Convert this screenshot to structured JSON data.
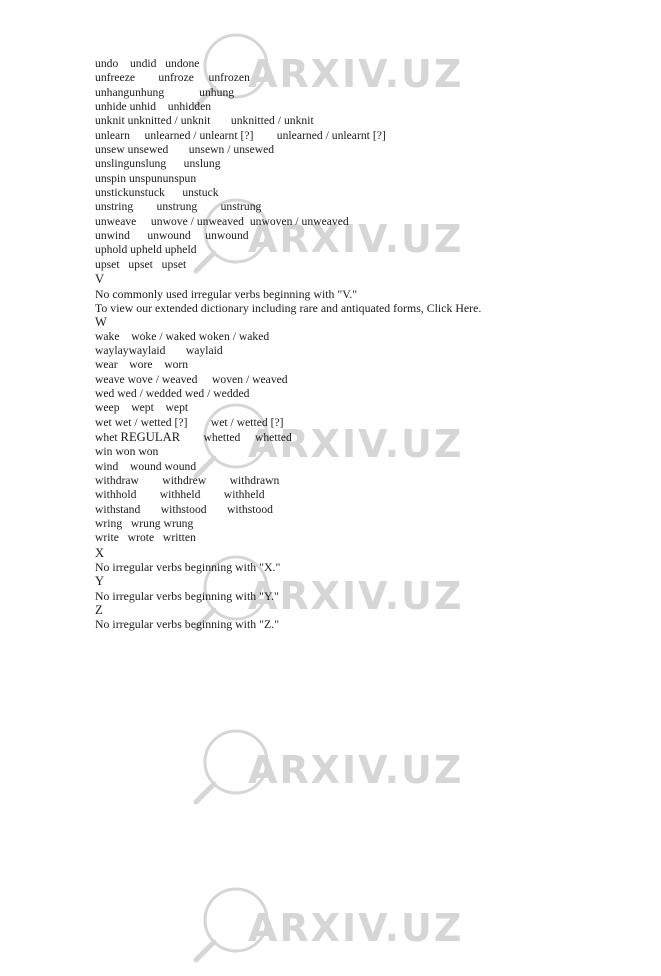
{
  "document": {
    "type": "irregular-verbs-reference",
    "watermark": {
      "text": "ARXIV.UZ",
      "icon": "magnifier-icon",
      "color": "#d6d6d6",
      "repeat_count": 5
    },
    "lines": [
      {
        "id": "l1",
        "kind": "verb",
        "text": "undo\tundid\tundone"
      },
      {
        "id": "l2",
        "kind": "verb",
        "text": "unfreeze\t\tunfroze\t\tunfrozen"
      },
      {
        "id": "l3",
        "kind": "verb",
        "text": "unhangunhung\t\t\tunhung"
      },
      {
        "id": "l4",
        "kind": "verb",
        "text": "unhide unhid\tunhidden"
      },
      {
        "id": "l5",
        "kind": "verb",
        "text": "unknit unknitted / unknit\t\tunknitted / unknit"
      },
      {
        "id": "l6",
        "kind": "verb",
        "text": "unlearn\t\tunlearned / unlearnt [?]\t\tunlearned / unlearnt [?]"
      },
      {
        "id": "l7",
        "kind": "verb",
        "text": "unsew unsewed\t\tunsewn / unsewed"
      },
      {
        "id": "l8",
        "kind": "verb",
        "text": "unslingunslung\t\tunslung"
      },
      {
        "id": "l9",
        "kind": "verb",
        "text": "unspin unspununspun"
      },
      {
        "id": "l10",
        "kind": "verb",
        "text": "unstickunstuck\t\tunstuck"
      },
      {
        "id": "l11",
        "kind": "verb",
        "text": "unstring\t\tunstrung\t\tunstrung"
      },
      {
        "id": "l12",
        "kind": "verb",
        "text": "unweave\t\tunwove / unweaved  unwoven / unweaved"
      },
      {
        "id": "l13",
        "kind": "verb",
        "text": "unwind\t\tunwound\t\tunwound"
      },
      {
        "id": "l14",
        "kind": "verb",
        "text": "uphold upheld upheld"
      },
      {
        "id": "l15",
        "kind": "verb",
        "text": "upset\tupset\tupset"
      },
      {
        "id": "l16",
        "kind": "heading",
        "text": "V"
      },
      {
        "id": "l17",
        "kind": "note",
        "text": "No commonly used irregular verbs beginning with \"V.\""
      },
      {
        "id": "l18",
        "kind": "note",
        "text": "To view our extended dictionary including rare and antiquated forms, Click Here."
      },
      {
        "id": "l19",
        "kind": "heading",
        "text": "W"
      },
      {
        "id": "l20",
        "kind": "verb",
        "text": "wake\twoke / waked woken / waked"
      },
      {
        "id": "l21",
        "kind": "verb",
        "text": "waylaywaylaid\t\twaylaid"
      },
      {
        "id": "l22",
        "kind": "verb",
        "text": "wear\twore\tworn"
      },
      {
        "id": "l23",
        "kind": "verb",
        "text": "weave wove / weaved\t\twoven / weaved"
      },
      {
        "id": "l24",
        "kind": "verb",
        "text": "wed\twed / wedded wed / wedded"
      },
      {
        "id": "l25",
        "kind": "verb",
        "text": "weep\twept\twept"
      },
      {
        "id": "l26",
        "kind": "verb",
        "text": "wet\twet / wetted [?]\t\twet / wetted [?]"
      },
      {
        "id": "l27",
        "kind": "verb-regular",
        "pre": "whet ",
        "regular": "REGULAR",
        "post": "\t\twhetted\t\twhetted"
      },
      {
        "id": "l28",
        "kind": "verb",
        "text": "win\twon\twon"
      },
      {
        "id": "l29",
        "kind": "verb",
        "text": "wind\twound wound"
      },
      {
        "id": "l30",
        "kind": "verb",
        "text": "withdraw\t\twithdrew\t\twithdrawn"
      },
      {
        "id": "l31",
        "kind": "verb",
        "text": "withhold\t\twithheld\t\twithheld"
      },
      {
        "id": "l32",
        "kind": "verb",
        "text": "withstand\t\twithstood\t\twithstood"
      },
      {
        "id": "l33",
        "kind": "verb",
        "text": "wring\twrung wrung"
      },
      {
        "id": "l34",
        "kind": "verb",
        "text": "write\twrote\twritten"
      },
      {
        "id": "l35",
        "kind": "heading",
        "text": "X"
      },
      {
        "id": "l36",
        "kind": "note",
        "text": "No irregular verbs beginning with \"X.\""
      },
      {
        "id": "l37",
        "kind": "heading",
        "text": "Y"
      },
      {
        "id": "l38",
        "kind": "note",
        "text": "No irregular verbs beginning with \"Y.\""
      },
      {
        "id": "l39",
        "kind": "heading",
        "text": "Z"
      },
      {
        "id": "l40",
        "kind": "note",
        "text": "No irregular verbs beginning with \"Z.\""
      }
    ]
  }
}
